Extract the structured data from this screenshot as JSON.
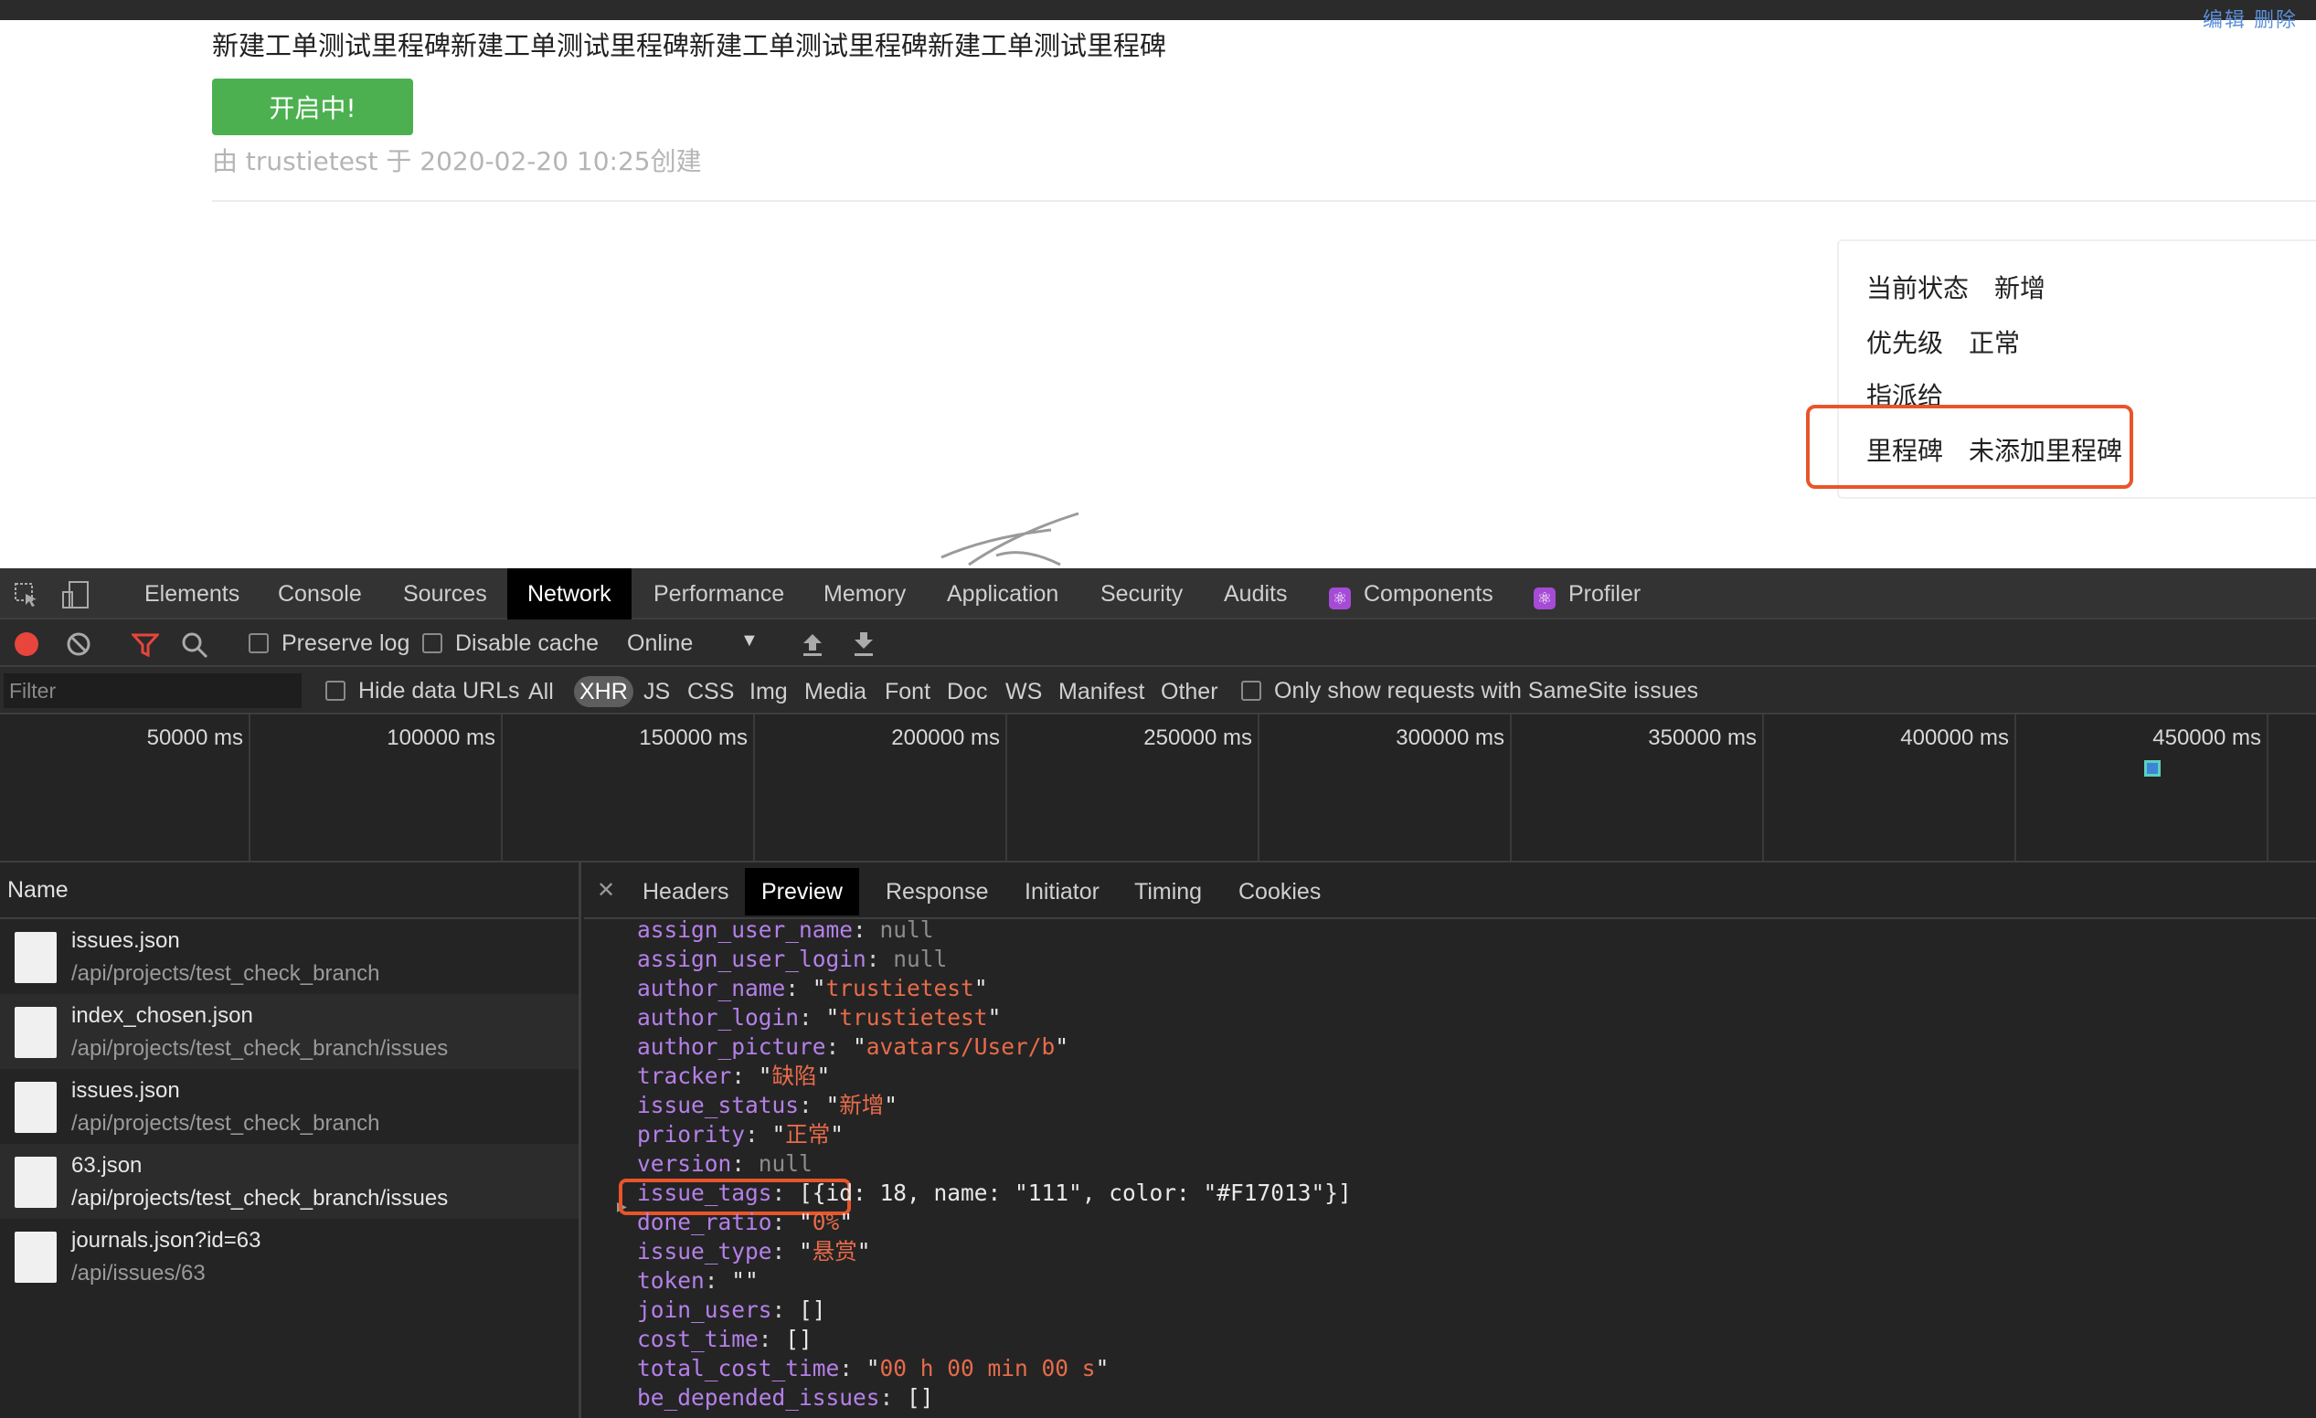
{
  "browser": {
    "edit_links": "编辑   删除"
  },
  "page": {
    "heading": "新建工单测试里程碑新建工单测试里程碑新建工单测试里程碑新建工单测试里程碑",
    "status_button": "开启中!",
    "created_info": "由 trustietest 于 2020-02-20 10:25创建",
    "sidebar": {
      "status_label": "当前状态",
      "status_value": "新增",
      "priority_label": "优先级",
      "priority_value": "正常",
      "assignee_label": "指派给",
      "milestone_label": "里程碑",
      "milestone_value": "未添加里程碑"
    }
  },
  "devtools": {
    "tabs": [
      "Elements",
      "Console",
      "Sources",
      "Network",
      "Performance",
      "Memory",
      "Application",
      "Security",
      "Audits",
      "Components",
      "Profiler"
    ],
    "active_tab": "Network",
    "toolbar": {
      "preserve_log": "Preserve log",
      "disable_cache": "Disable cache",
      "throttle": "Online"
    },
    "filterbar": {
      "filter_placeholder": "Filter",
      "hide_data_urls": "Hide data URLs",
      "types": [
        "All",
        "XHR",
        "JS",
        "CSS",
        "Img",
        "Media",
        "Font",
        "Doc",
        "WS",
        "Manifest",
        "Other"
      ],
      "active_type": "XHR",
      "samesite": "Only show requests with SameSite issues"
    },
    "timeline_ticks": [
      "50000 ms",
      "100000 ms",
      "150000 ms",
      "200000 ms",
      "250000 ms",
      "300000 ms",
      "350000 ms",
      "400000 ms",
      "450000 ms"
    ],
    "name_header": "Name",
    "requests": [
      {
        "name": "issues.json",
        "path": "/api/projects/test_check_branch"
      },
      {
        "name": "index_chosen.json",
        "path": "/api/projects/test_check_branch/issues"
      },
      {
        "name": "issues.json",
        "path": "/api/projects/test_check_branch"
      },
      {
        "name": "63.json",
        "path": "/api/projects/test_check_branch/issues"
      },
      {
        "name": "journals.json?id=63",
        "path": "/api/issues/63"
      }
    ],
    "detail_tabs": [
      "Headers",
      "Preview",
      "Response",
      "Initiator",
      "Timing",
      "Cookies"
    ],
    "active_detail_tab": "Preview",
    "preview": [
      {
        "key": "assign_user_name",
        "value": "null",
        "kind": "null"
      },
      {
        "key": "assign_user_login",
        "value": "null",
        "kind": "null"
      },
      {
        "key": "author_name",
        "value": "trustietest",
        "kind": "str"
      },
      {
        "key": "author_login",
        "value": "trustietest",
        "kind": "str"
      },
      {
        "key": "author_picture",
        "value": "avatars/User/b",
        "kind": "str"
      },
      {
        "key": "tracker",
        "value": "缺陷",
        "kind": "str"
      },
      {
        "key": "issue_status",
        "value": "新增",
        "kind": "str"
      },
      {
        "key": "priority",
        "value": "正常",
        "kind": "str"
      },
      {
        "key": "version",
        "value": "null",
        "kind": "null"
      },
      {
        "key": "issue_tags",
        "value": "[{id: 18, name: \"111\", color: \"#F17013\"}]",
        "kind": "plain"
      },
      {
        "key": "done_ratio",
        "value": "0%",
        "kind": "str"
      },
      {
        "key": "issue_type",
        "value": "悬赏",
        "kind": "str"
      },
      {
        "key": "token",
        "value": "",
        "kind": "str"
      },
      {
        "key": "join_users",
        "value": "[]",
        "kind": "plain"
      },
      {
        "key": "cost_time",
        "value": "[]",
        "kind": "plain"
      },
      {
        "key": "total_cost_time",
        "value": "00 h 00 min 00 s",
        "kind": "str"
      },
      {
        "key": "be_depended_issues",
        "value": "[]",
        "kind": "plain"
      }
    ],
    "colors": {
      "string": "#e86b4a",
      "key": "#b580e8",
      "null": "#8c8c8c",
      "highlight": "#e8552a"
    }
  }
}
